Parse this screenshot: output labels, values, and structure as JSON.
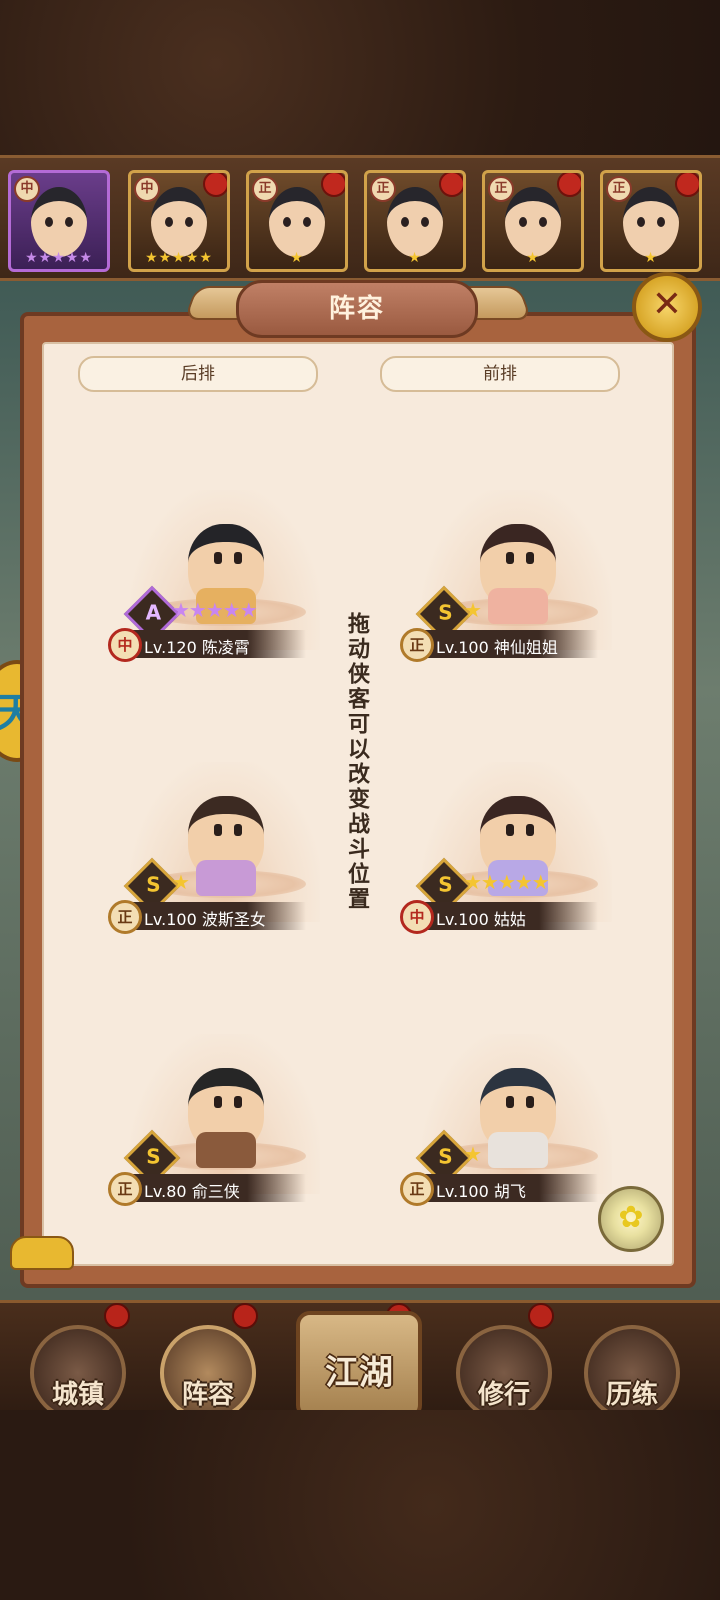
{
  "title": "阵容",
  "close_icon": "close-icon",
  "hint": "拖动侠客可以改变战斗位置",
  "columns": {
    "back": "后排",
    "front": "前排"
  },
  "hero_strip": [
    {
      "rank": "中",
      "stars": "★★★★★",
      "selected": true
    },
    {
      "rank": "中",
      "stars": "★★★★★",
      "selected": false
    },
    {
      "rank": "正",
      "stars": "★",
      "selected": false
    },
    {
      "rank": "正",
      "stars": "★",
      "selected": false
    },
    {
      "rank": "正",
      "stars": "★",
      "selected": false
    },
    {
      "rank": "正",
      "stars": "★",
      "selected": false
    }
  ],
  "formation": [
    {
      "rank": "中",
      "grade": "A",
      "stars": "★★★★★",
      "level": "Lv.120",
      "name": "陈凌霄",
      "star_color": "purple"
    },
    {
      "rank": "正",
      "grade": "S",
      "stars": "★",
      "level": "Lv.100",
      "name": "神仙姐姐",
      "star_color": "gold"
    },
    {
      "rank": "正",
      "grade": "S",
      "stars": "★",
      "level": "Lv.100",
      "name": "波斯圣女",
      "star_color": "gold"
    },
    {
      "rank": "中",
      "grade": "S",
      "stars": "★★★★★",
      "level": "Lv.100",
      "name": "姑姑",
      "star_color": "gold"
    },
    {
      "rank": "正",
      "grade": "S",
      "stars": "★",
      "level": "Lv.80",
      "name": "俞三侠",
      "star_color": "gold"
    },
    {
      "rank": "正",
      "grade": "S",
      "stars": "★",
      "level": "Lv.100",
      "name": "胡飞",
      "star_color": "gold"
    }
  ],
  "side_icon": "天",
  "nav": {
    "town": "城镇",
    "lineup": "阵容",
    "jianghu": "江湖",
    "training": "修行",
    "trial": "历练"
  }
}
